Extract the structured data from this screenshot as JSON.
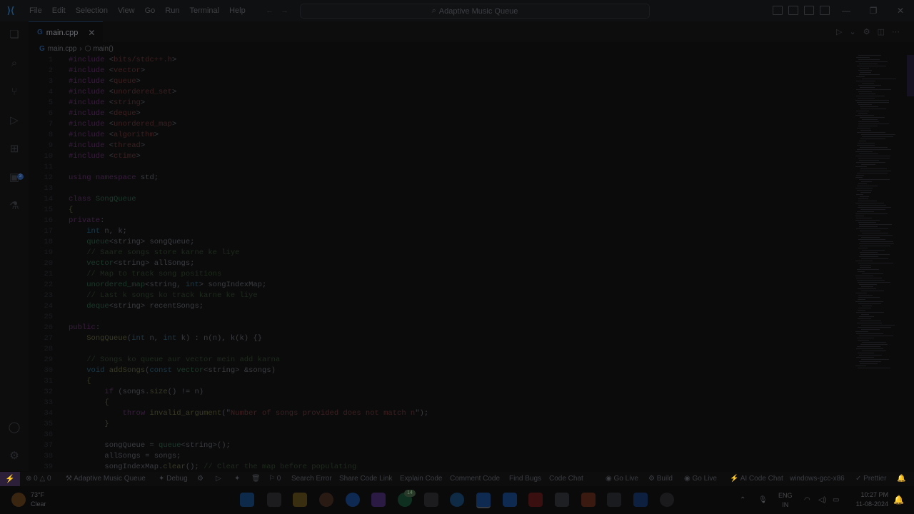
{
  "window": {
    "title": "Adaptive Music Queue",
    "menu": [
      "File",
      "Edit",
      "Selection",
      "View",
      "Go",
      "Run",
      "Terminal",
      "Help"
    ]
  },
  "tab": {
    "filename": "main.cpp",
    "icon": "cpp-file-icon"
  },
  "breadcrumb": {
    "file": "main.cpp",
    "symbol": "main()"
  },
  "code": [
    {
      "n": "1",
      "t": [
        [
          "kw",
          "#include"
        ],
        [
          "pl",
          " <"
        ],
        [
          "str",
          "bits/stdc++.h"
        ],
        [
          "pl",
          ">"
        ]
      ]
    },
    {
      "n": "2",
      "t": [
        [
          "kw",
          "#include"
        ],
        [
          "pl",
          " <"
        ],
        [
          "str",
          "vector"
        ],
        [
          "pl",
          ">"
        ]
      ]
    },
    {
      "n": "3",
      "t": [
        [
          "kw",
          "#include"
        ],
        [
          "pl",
          " <"
        ],
        [
          "str",
          "queue"
        ],
        [
          "pl",
          ">"
        ]
      ]
    },
    {
      "n": "4",
      "t": [
        [
          "kw",
          "#include"
        ],
        [
          "pl",
          " <"
        ],
        [
          "str",
          "unordered_set"
        ],
        [
          "pl",
          ">"
        ]
      ]
    },
    {
      "n": "5",
      "t": [
        [
          "kw",
          "#include"
        ],
        [
          "pl",
          " <"
        ],
        [
          "str",
          "string"
        ],
        [
          "pl",
          ">"
        ]
      ]
    },
    {
      "n": "6",
      "t": [
        [
          "kw",
          "#include"
        ],
        [
          "pl",
          " <"
        ],
        [
          "str",
          "deque"
        ],
        [
          "pl",
          ">"
        ]
      ]
    },
    {
      "n": "7",
      "t": [
        [
          "kw",
          "#include"
        ],
        [
          "pl",
          " <"
        ],
        [
          "str",
          "unordered_map"
        ],
        [
          "pl",
          ">"
        ]
      ]
    },
    {
      "n": "8",
      "t": [
        [
          "kw",
          "#include"
        ],
        [
          "pl",
          " <"
        ],
        [
          "str",
          "algorithm"
        ],
        [
          "pl",
          ">"
        ]
      ]
    },
    {
      "n": "9",
      "t": [
        [
          "kw",
          "#include"
        ],
        [
          "pl",
          " <"
        ],
        [
          "str",
          "thread"
        ],
        [
          "pl",
          ">"
        ]
      ]
    },
    {
      "n": "10",
      "t": [
        [
          "kw",
          "#include"
        ],
        [
          "pl",
          " <"
        ],
        [
          "str",
          "ctime"
        ],
        [
          "pl",
          ">"
        ]
      ]
    },
    {
      "n": "11",
      "t": []
    },
    {
      "n": "12",
      "t": [
        [
          "kw",
          "using"
        ],
        [
          "pl",
          " "
        ],
        [
          "kw",
          "namespace"
        ],
        [
          "pl",
          " std;"
        ]
      ]
    },
    {
      "n": "13",
      "t": []
    },
    {
      "n": "14",
      "t": [
        [
          "kw",
          "class"
        ],
        [
          "pl",
          " "
        ],
        [
          "ct",
          "SongQueue"
        ]
      ]
    },
    {
      "n": "15",
      "t": [
        [
          "fn",
          "{"
        ]
      ]
    },
    {
      "n": "16",
      "t": [
        [
          "kw",
          "private"
        ],
        [
          "pl",
          ":"
        ]
      ]
    },
    {
      "n": "17",
      "t": [
        [
          "pl",
          "    "
        ],
        [
          "ty",
          "int"
        ],
        [
          "pl",
          " n, k;"
        ]
      ]
    },
    {
      "n": "18",
      "t": [
        [
          "pl",
          "    "
        ],
        [
          "ct",
          "queue"
        ],
        [
          "pl",
          "<string> songQueue;"
        ]
      ]
    },
    {
      "n": "19",
      "t": [
        [
          "pl",
          "    "
        ],
        [
          "cm",
          "// Saare songs store karne ke liye"
        ]
      ]
    },
    {
      "n": "20",
      "t": [
        [
          "pl",
          "    "
        ],
        [
          "ct",
          "vector"
        ],
        [
          "pl",
          "<string> allSongs;"
        ]
      ]
    },
    {
      "n": "21",
      "t": [
        [
          "pl",
          "    "
        ],
        [
          "cm",
          "// Map to track song positions"
        ]
      ]
    },
    {
      "n": "22",
      "t": [
        [
          "pl",
          "    "
        ],
        [
          "ct",
          "unordered_map"
        ],
        [
          "pl",
          "<string, "
        ],
        [
          "ty",
          "int"
        ],
        [
          "pl",
          "> songIndexMap;"
        ]
      ]
    },
    {
      "n": "23",
      "t": [
        [
          "pl",
          "    "
        ],
        [
          "cm",
          "// Last k songs ko track karne ke liye"
        ]
      ]
    },
    {
      "n": "24",
      "t": [
        [
          "pl",
          "    "
        ],
        [
          "ct",
          "deque"
        ],
        [
          "pl",
          "<string> recentSongs;"
        ]
      ]
    },
    {
      "n": "25",
      "t": []
    },
    {
      "n": "26",
      "t": [
        [
          "kw",
          "public"
        ],
        [
          "pl",
          ":"
        ]
      ]
    },
    {
      "n": "27",
      "t": [
        [
          "pl",
          "    "
        ],
        [
          "fn",
          "SongQueue"
        ],
        [
          "pl",
          "("
        ],
        [
          "ty",
          "int"
        ],
        [
          "pl",
          " n, "
        ],
        [
          "ty",
          "int"
        ],
        [
          "pl",
          " k) : n(n), k(k) {}"
        ]
      ]
    },
    {
      "n": "28",
      "t": []
    },
    {
      "n": "29",
      "t": [
        [
          "pl",
          "    "
        ],
        [
          "cm",
          "// Songs ko queue aur vector mein add karna"
        ]
      ]
    },
    {
      "n": "30",
      "t": [
        [
          "pl",
          "    "
        ],
        [
          "ty",
          "void"
        ],
        [
          "pl",
          " "
        ],
        [
          "fn",
          "addSongs"
        ],
        [
          "pl",
          "("
        ],
        [
          "ty",
          "const"
        ],
        [
          "pl",
          " "
        ],
        [
          "ct",
          "vector"
        ],
        [
          "pl",
          "<string> &songs)"
        ]
      ]
    },
    {
      "n": "31",
      "t": [
        [
          "pl",
          "    "
        ],
        [
          "fn",
          "{"
        ]
      ]
    },
    {
      "n": "32",
      "t": [
        [
          "pl",
          "        "
        ],
        [
          "kw",
          "if"
        ],
        [
          "pl",
          " (songs."
        ],
        [
          "fn",
          "size"
        ],
        [
          "pl",
          "() != n)"
        ]
      ]
    },
    {
      "n": "33",
      "t": [
        [
          "pl",
          "        "
        ],
        [
          "fn",
          "{"
        ]
      ]
    },
    {
      "n": "34",
      "t": [
        [
          "pl",
          "            "
        ],
        [
          "kw",
          "throw"
        ],
        [
          "pl",
          " "
        ],
        [
          "fn",
          "invalid_argument"
        ],
        [
          "pl",
          "(\""
        ],
        [
          "str",
          "Number of songs provided does not match n"
        ],
        [
          "pl",
          "\");"
        ]
      ]
    },
    {
      "n": "35",
      "t": [
        [
          "pl",
          "        "
        ],
        [
          "fn",
          "}"
        ]
      ]
    },
    {
      "n": "36",
      "t": []
    },
    {
      "n": "37",
      "t": [
        [
          "pl",
          "        songQueue = "
        ],
        [
          "ct",
          "queue"
        ],
        [
          "pl",
          "<string>();"
        ]
      ]
    },
    {
      "n": "38",
      "t": [
        [
          "pl",
          "        allSongs = songs;"
        ]
      ]
    },
    {
      "n": "39",
      "t": [
        [
          "pl",
          "        songIndexMap."
        ],
        [
          "fn",
          "clear"
        ],
        [
          "pl",
          "(); "
        ],
        [
          "cm",
          "// Clear the map before populating"
        ]
      ]
    }
  ],
  "status": {
    "remote": "⚡",
    "errors": "0",
    "warnings": "0",
    "project": "Adaptive Music Queue",
    "debug": "Debug",
    "zero": "0",
    "search_error": "Search Error",
    "share": "Share Code Link",
    "explain": "Explain Code",
    "comment": "Comment Code",
    "find_bugs": "Find Bugs",
    "code_chat": "Code Chat",
    "go_live": "Go Live",
    "build": "Build",
    "go_live2": "Go Live",
    "ai_chat": "AI Code Chat",
    "compiler": "windows-gcc-x86",
    "prettier": "Prettier"
  },
  "taskbar": {
    "temperature": "73°F",
    "condition": "Clear",
    "lang": "ENG",
    "region": "IN",
    "time": "10:27 PM",
    "date": "11-08-2024",
    "whatsapp_badge": "14"
  }
}
